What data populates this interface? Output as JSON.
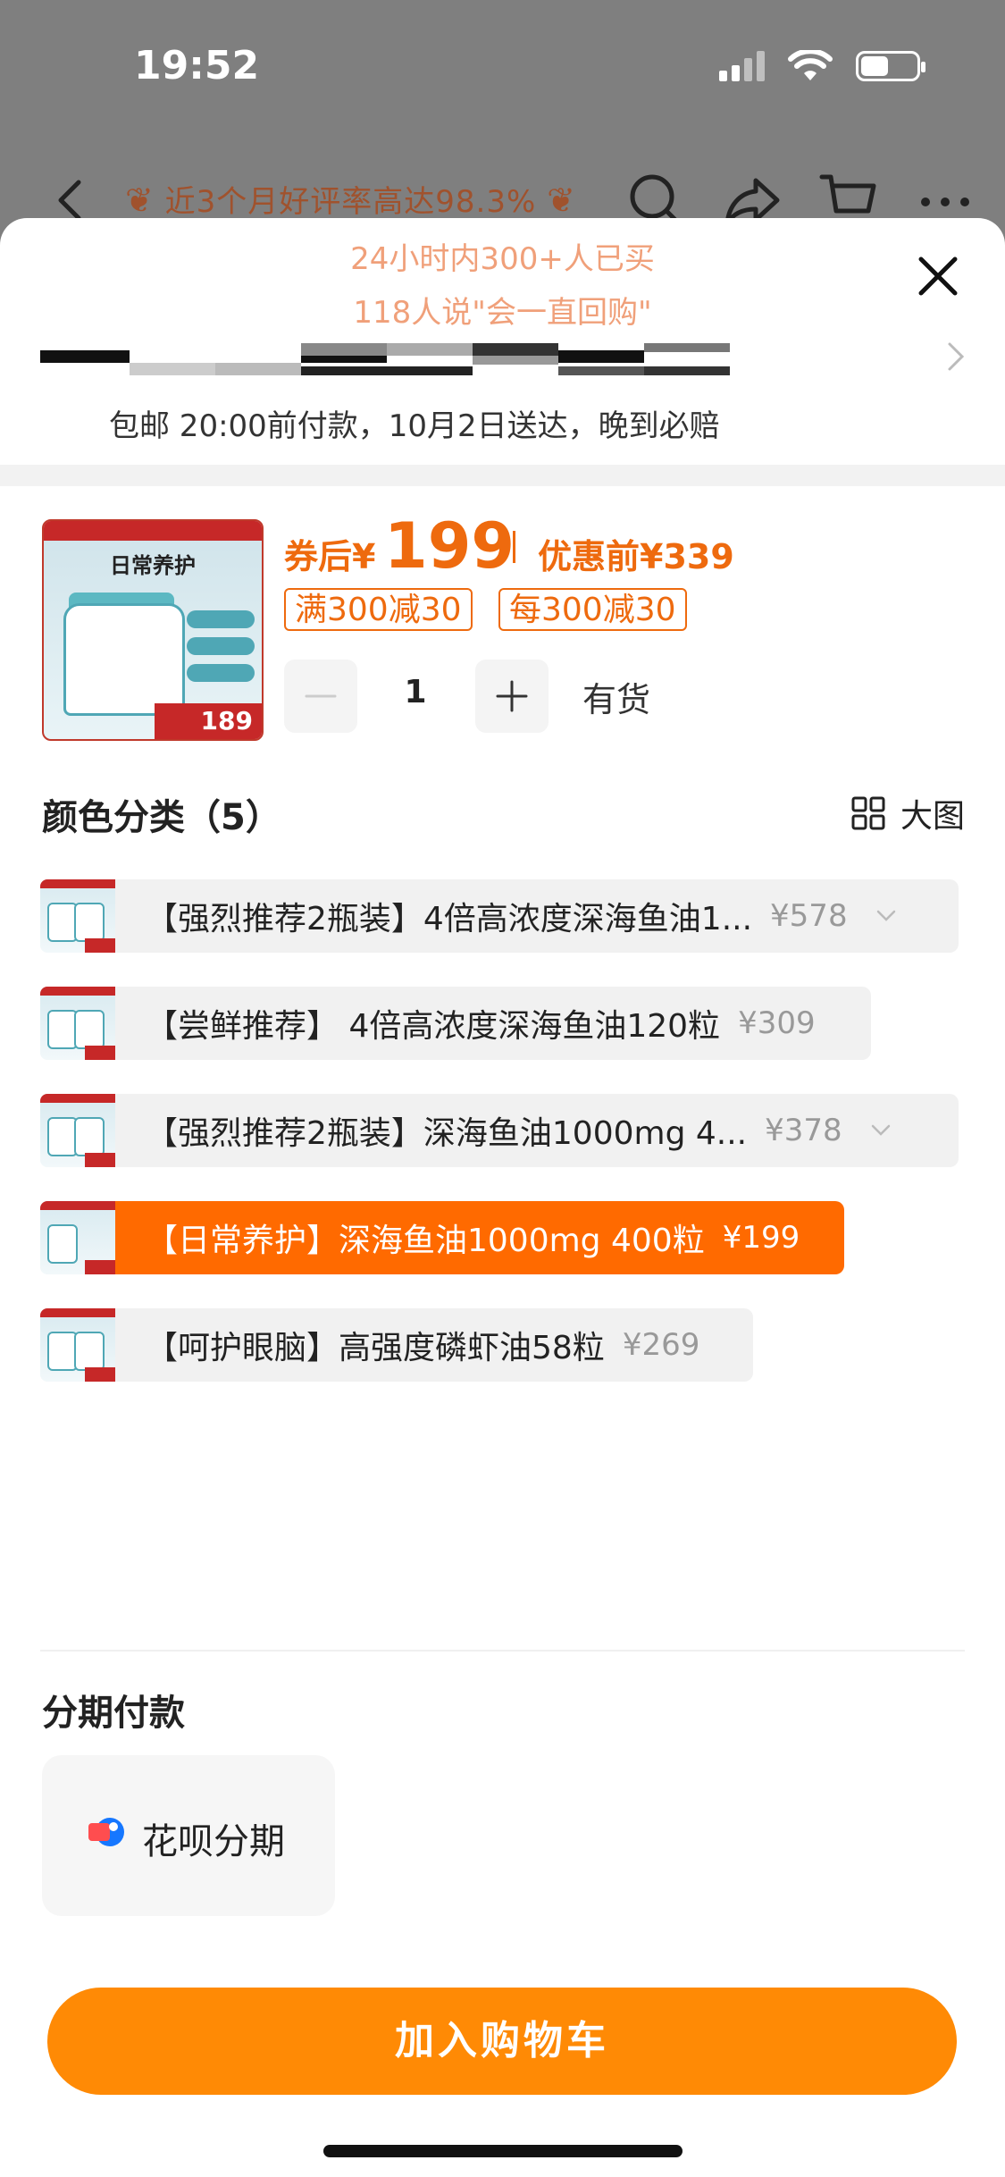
{
  "status_bar": {
    "time": "19:52"
  },
  "top_nav": {
    "rating_text": "近3个月好评率高达98.3%"
  },
  "sheet": {
    "social_proof": [
      "24小时内300+人已买",
      "118人说\"会一直回购\""
    ],
    "shipping": "包邮 20:00前付款，10月2日送达，晚到必赔",
    "product": {
      "image_title": "日常养护",
      "image_price": "189",
      "after_coupon_label": "券后¥",
      "after_coupon_price": "199",
      "before_label": "优惠前¥339",
      "coupons": [
        "满300减30",
        "每300减30"
      ],
      "quantity": "1",
      "stock": "有货"
    },
    "color_section": {
      "title": "颜色分类（5）",
      "big_view_label": "大图",
      "options": [
        {
          "name": "【强烈推荐2瓶装】4倍高浓度深海鱼油1...",
          "price": "¥578",
          "selected": false
        },
        {
          "name": "【尝鲜推荐】 4倍高浓度深海鱼油120粒",
          "price": "¥309",
          "selected": false
        },
        {
          "name": "【强烈推荐2瓶装】深海鱼油1000mg 4...",
          "price": "¥378",
          "selected": false
        },
        {
          "name": "【日常养护】深海鱼油1000mg 400粒",
          "price": "¥199",
          "selected": true
        },
        {
          "name": "【呵护眼脑】高强度磷虾油58粒",
          "price": "¥269",
          "selected": false
        }
      ]
    },
    "installment": {
      "title": "分期付款",
      "option_label": "花呗分期"
    },
    "add_to_cart": "加入购物车"
  },
  "colors": {
    "accent": "#ff6a00",
    "cart_button": "#ff8a05",
    "price": "#ee6a0e"
  }
}
